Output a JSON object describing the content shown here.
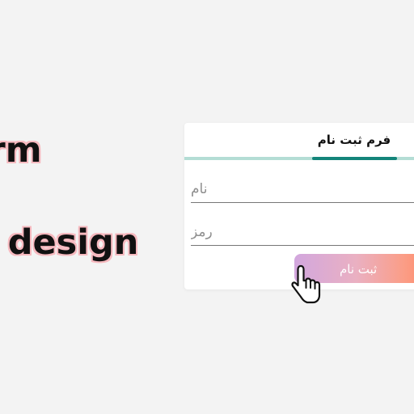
{
  "headline": {
    "line1": "orm",
    "line2": "l design"
  },
  "form": {
    "title": "فرم ثبت نام",
    "name_placeholder": "نام",
    "password_placeholder": "رمز",
    "submit_label": "ثبت نام"
  },
  "colors": {
    "background": "#f3f3f3",
    "tab_inactive": "#b4ddd5",
    "tab_active": "#13857a",
    "button_gradient_start": "#d2a7de",
    "button_gradient_end": "#ff8866",
    "headline_outline": "#f6b9bf"
  },
  "icons": {
    "cursor": "hand-pointer-icon"
  }
}
